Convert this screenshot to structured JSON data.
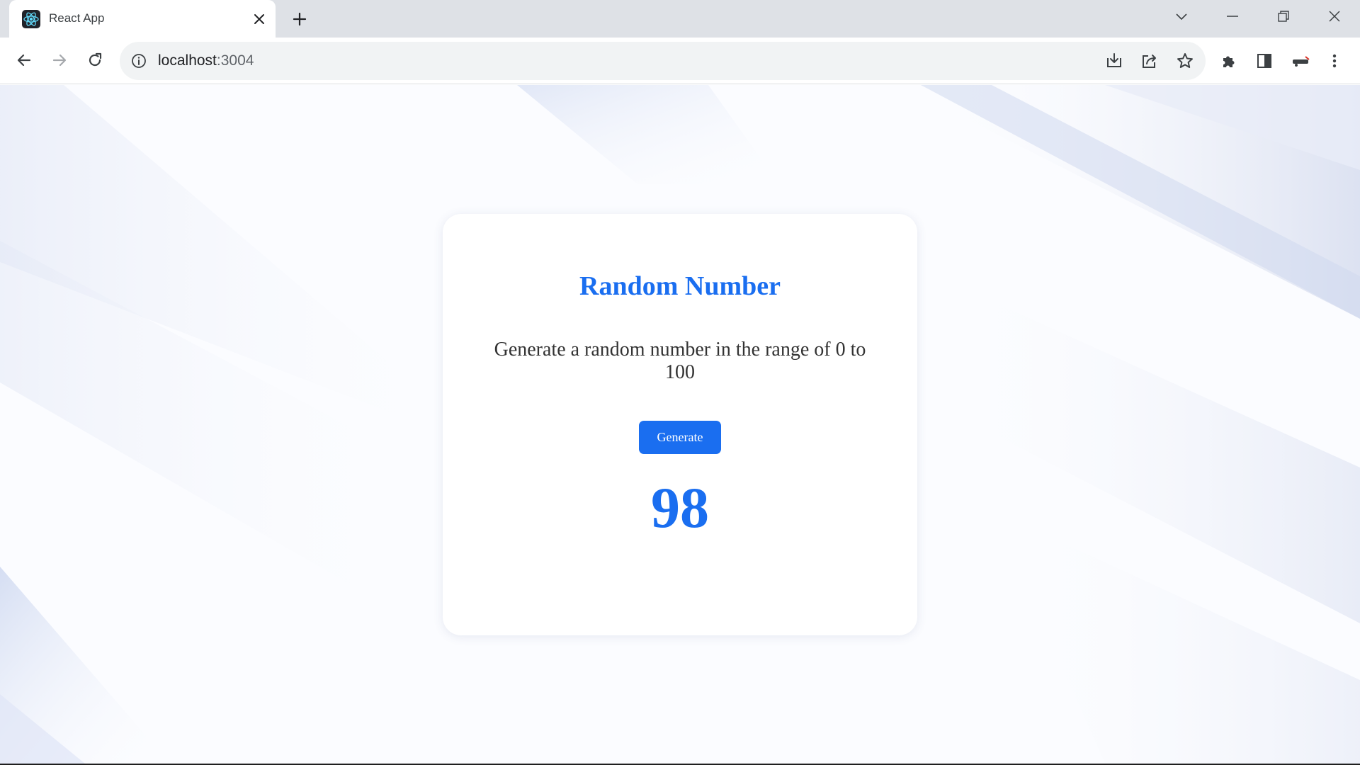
{
  "browser": {
    "tab": {
      "title": "React App",
      "favicon": "react-logo-icon"
    },
    "address_bar": {
      "host": "localhost",
      "port": ":3004"
    },
    "icons": {
      "back": "arrow-left-icon",
      "forward": "arrow-right-icon",
      "reload": "reload-icon",
      "site_info": "info-icon",
      "install": "install-app-icon",
      "share": "share-icon",
      "bookmark": "star-icon",
      "extensions": "puzzle-icon",
      "side_panel": "side-panel-icon",
      "menu": "kebab-menu-icon"
    }
  },
  "card": {
    "title": "Random Number",
    "description": "Generate a random number in the range of 0 to 100",
    "button_label": "Generate",
    "result": "98"
  },
  "colors": {
    "accent": "#1a6ef0",
    "text": "#333333",
    "chrome_bg": "#dee1e6",
    "omnibox_bg": "#f1f3f4"
  }
}
